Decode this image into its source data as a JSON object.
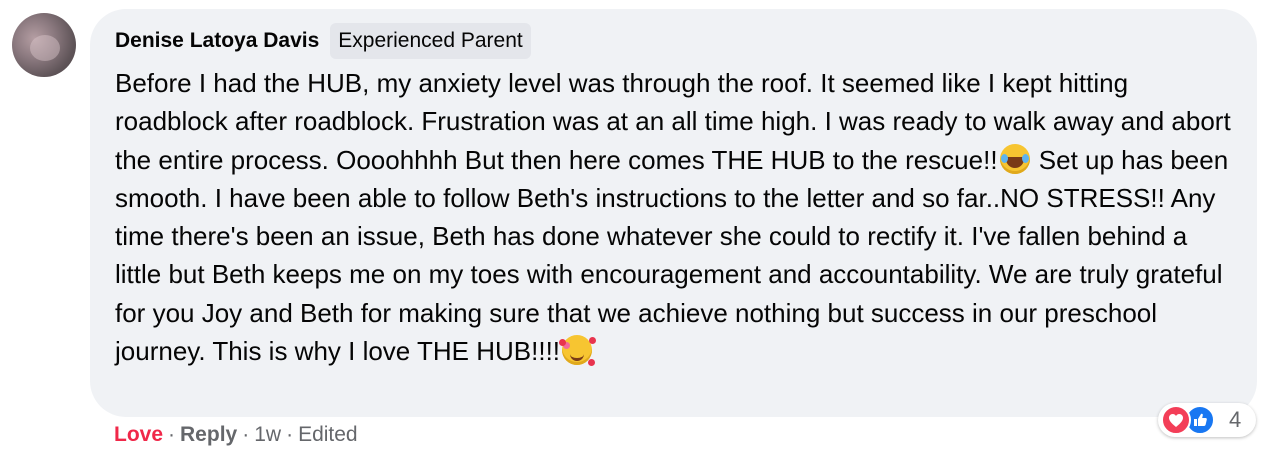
{
  "comment": {
    "author": "Denise Latoya Davis",
    "badge": "Experienced Parent",
    "text_part1": "Before I had the HUB, my anxiety level was through the roof. It seemed like I kept hitting roadblock after roadblock. Frustration was at an all time high. I was ready to walk away and abort the entire process. Oooohhhh But then here comes THE HUB to the rescue!!",
    "emoji1": "laughing-with-tears-emoji",
    "text_part2": " Set up has been smooth. I have been able to follow Beth's instructions to the letter and so far..NO STRESS!! Any time there's been an issue, Beth has done whatever she could to rectify it. I've fallen behind a little but Beth keeps me on my toes with encouragement and accountability. We are truly grateful for you Joy and Beth for making sure that we achieve nothing but success in our preschool journey. This is why I love THE HUB!!!!",
    "emoji2": "smiling-face-with-hearts-emoji"
  },
  "reactions": {
    "icons": [
      "love-reaction-icon",
      "like-reaction-icon"
    ],
    "count": "4"
  },
  "actions": {
    "love_label": "Love",
    "separator": "·",
    "reply_label": "Reply",
    "time": "1w",
    "edited": "Edited"
  },
  "colors": {
    "bubble": "#f0f2f5",
    "love": "#f02849",
    "like": "#1877f2",
    "meta": "#65676b"
  }
}
